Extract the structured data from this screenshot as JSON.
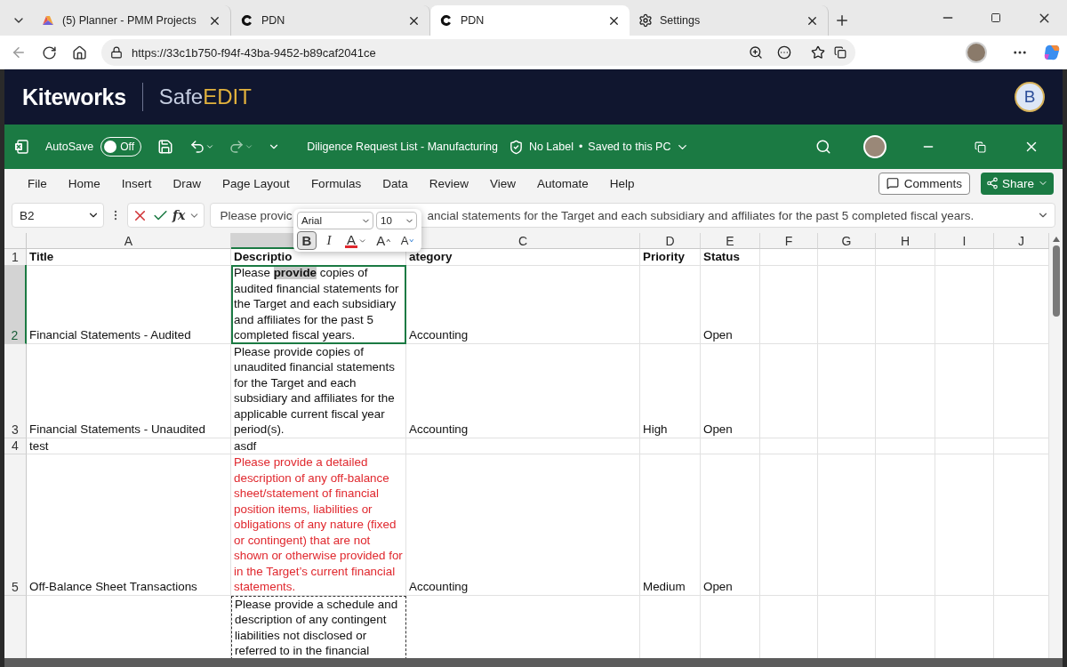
{
  "browser": {
    "tabs": [
      {
        "kind": "planner",
        "title": "(5) Planner - PMM Projects",
        "selected": false
      },
      {
        "kind": "pdn",
        "title": "PDN",
        "selected": false
      },
      {
        "kind": "pdn",
        "title": "PDN",
        "selected": true
      },
      {
        "kind": "settings",
        "title": "Settings",
        "selected": false
      }
    ],
    "url": "https://33c1b750-f94f-43ba-9452-b89caf2041ce"
  },
  "app_header": {
    "brand": "Kiteworks",
    "product_prefix": "Safe",
    "product_suffix": "EDIT",
    "avatar": "B"
  },
  "excel": {
    "autosave_label": "AutoSave",
    "autosave": {
      "on": false,
      "label": "Off"
    },
    "document_title": "Diligence Request List - Manufacturing",
    "sensitivity": "No Label",
    "separator": "•",
    "save_status": "Saved to this PC",
    "menu": [
      "File",
      "Home",
      "Insert",
      "Draw",
      "Page Layout",
      "Formulas",
      "Data",
      "Review",
      "View",
      "Automate",
      "Help"
    ],
    "comments": "Comments",
    "share": "Share"
  },
  "formula_bar": {
    "name_box": "B2",
    "fx": "fx",
    "text_before": "Please provic",
    "text_after": "ancial statements for the Target and each subsidiary and affiliates for the past 5 completed fiscal years."
  },
  "format_popup": {
    "font": "Arial",
    "size": "10",
    "buttons": [
      {
        "kind": "bold",
        "label": "B",
        "selected": true
      },
      {
        "kind": "italic",
        "label": "I",
        "selected": false
      },
      {
        "kind": "font_color",
        "label": "A",
        "color": "#e0282e"
      },
      {
        "kind": "grow",
        "label": "A"
      },
      {
        "kind": "shrink",
        "label": "A"
      }
    ]
  },
  "sheet": {
    "columns": [
      {
        "letter": "A",
        "selected": false
      },
      {
        "selected": true
      },
      {
        "letter": "C",
        "selected": false
      },
      {
        "letter": "D",
        "selected": false
      },
      {
        "letter": "E",
        "selected": false
      },
      {
        "letter": "F",
        "selected": false
      },
      {
        "letter": "G",
        "selected": false
      },
      {
        "letter": "H",
        "selected": false
      },
      {
        "letter": "I",
        "selected": false
      },
      {
        "letter": "J",
        "selected": false
      }
    ],
    "header_row": {
      "number": "1",
      "title": "Title",
      "description": "Descriptio",
      "category": "ategory",
      "priority": "Priority",
      "status": "Status"
    },
    "rows": [
      {
        "number": "2",
        "selected": true,
        "title": "Financial Statements - Audited",
        "description": {
          "lines": [
            "Please **provide** copies of",
            "audited financial statements for",
            "the Target and each subsidiary",
            "and affiliates for the past 5",
            "completed fiscal years."
          ],
          "selected": true,
          "copied": false
        },
        "category": "Accounting",
        "status": "Open"
      },
      {
        "number": "3",
        "selected": false,
        "title": "Financial Statements - Unaudited",
        "description": {
          "lines": [
            "Please provide copies of",
            "unaudited financial statements",
            "for the Target and each",
            "subsidiary and affiliates for the",
            "applicable current fiscal year",
            "period(s)."
          ],
          "selected": false,
          "copied": false
        },
        "category": "Accounting",
        "priority": "High",
        "status": "Open"
      },
      {
        "number": "4",
        "selected": false,
        "title": "test",
        "description": {
          "lines": [
            "asdf"
          ],
          "selected": false,
          "copied": false
        }
      },
      {
        "number": "5",
        "selected": false,
        "title": "Off-Balance Sheet Transactions",
        "description": {
          "lines": [
            "Please provide a detailed",
            "description of any off-balance",
            "sheet/statement of financial",
            "position items, liabilities or",
            "obligations of any nature (fixed",
            "or contingent) that are not",
            "shown or otherwise provided for",
            "in the Target’s current financial",
            "statements."
          ],
          "selected": false,
          "copied": false,
          "color": "#e0282e"
        },
        "category": "Accounting",
        "priority": "Medium",
        "status": "Open"
      },
      {
        "selected": false,
        "description": {
          "lines": [
            "Please provide a schedule and",
            "description of any contingent",
            "liabilities not disclosed or",
            "referred to in the financial"
          ],
          "selected": false,
          "copied": true
        }
      }
    ]
  }
}
